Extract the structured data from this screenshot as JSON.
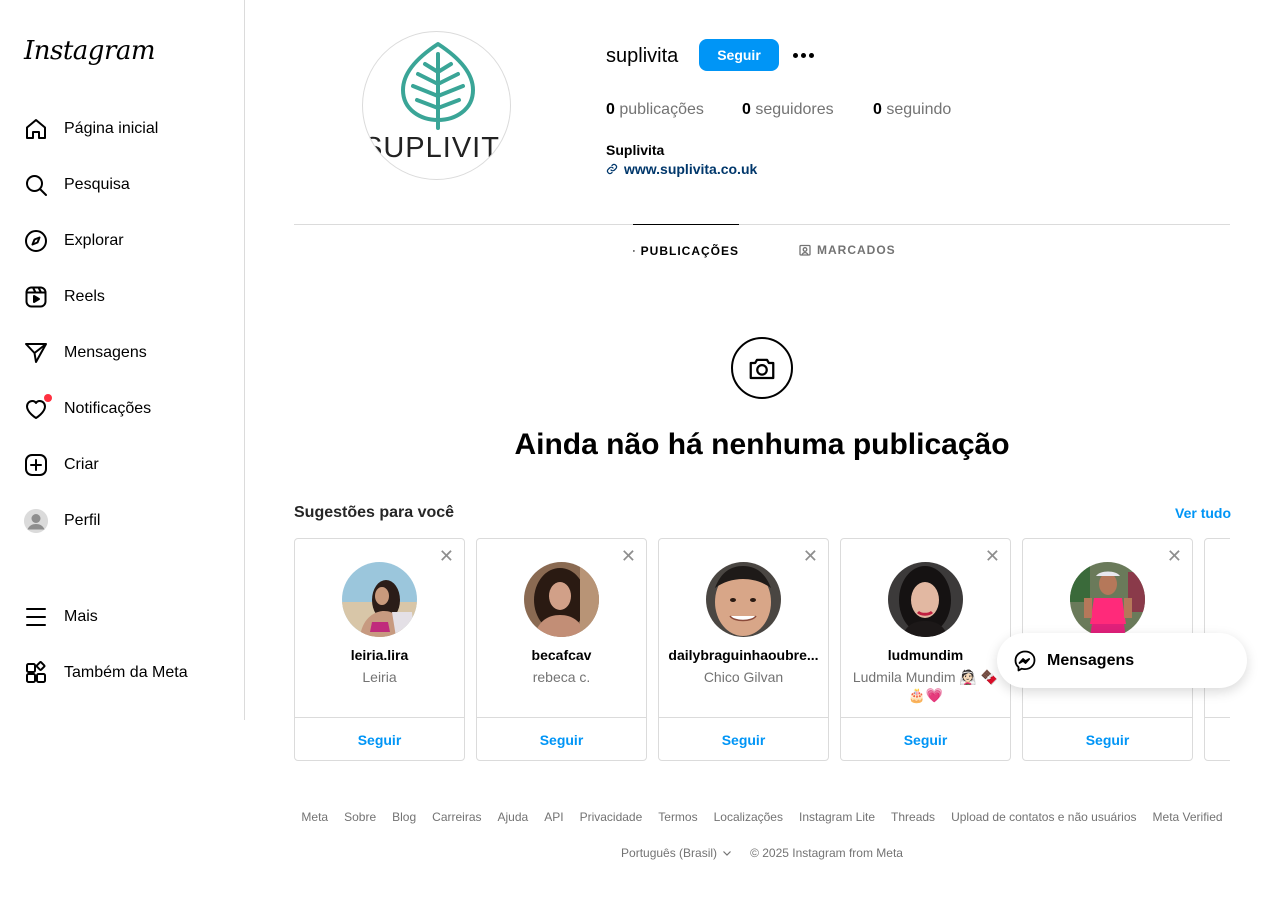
{
  "sidebar": {
    "logo": "Instagram",
    "items": [
      {
        "label": "Página inicial",
        "icon": "home-icon"
      },
      {
        "label": "Pesquisa",
        "icon": "search-icon"
      },
      {
        "label": "Explorar",
        "icon": "compass-icon"
      },
      {
        "label": "Reels",
        "icon": "reels-icon"
      },
      {
        "label": "Mensagens",
        "icon": "paper-plane-icon"
      },
      {
        "label": "Notificações",
        "icon": "heart-icon"
      },
      {
        "label": "Criar",
        "icon": "plus-square-icon"
      },
      {
        "label": "Perfil",
        "icon": "avatar-icon"
      }
    ],
    "more": {
      "label": "Mais",
      "icon": "menu-icon"
    },
    "meta": {
      "label": "Também da Meta",
      "icon": "grid-icon"
    }
  },
  "profile": {
    "username": "suplivita",
    "follow_label": "Seguir",
    "pic_text": "SUPLIVITA",
    "stats": {
      "posts_count": "0",
      "posts_label": "publicações",
      "followers_count": "0",
      "followers_label": "seguidores",
      "following_count": "0",
      "following_label": "seguindo"
    },
    "full_name": "Suplivita",
    "website": "www.suplivita.co.uk"
  },
  "tabs": [
    {
      "label": "PUBLICAÇÕES",
      "icon": "grid-icon",
      "active": true
    },
    {
      "label": "MARCADOS",
      "icon": "tagged-icon",
      "active": false
    }
  ],
  "empty_state": {
    "icon": "camera-icon",
    "title": "Ainda não há nenhuma publicação"
  },
  "suggestions": {
    "title": "Sugestões para você",
    "see_all": "Ver tudo",
    "follow_label": "Seguir",
    "cards": [
      {
        "username": "leiria.lira",
        "name": "Leiria"
      },
      {
        "username": "becafcav",
        "name": "rebeca c."
      },
      {
        "username": "dailybraguinhaoubre...",
        "name": "Chico Gilvan"
      },
      {
        "username": "ludmundim",
        "name": "Ludmila Mundim 👰🏻 🍫🎂💗"
      },
      {
        "username": "",
        "name": ""
      }
    ]
  },
  "messages_float": {
    "label": "Mensagens",
    "icon": "messenger-icon"
  },
  "footer": {
    "links": [
      "Meta",
      "Sobre",
      "Blog",
      "Carreiras",
      "Ajuda",
      "API",
      "Privacidade",
      "Termos",
      "Localizações",
      "Instagram Lite",
      "Threads",
      "Upload de contatos e não usuários",
      "Meta Verified"
    ],
    "language": "Português (Brasil)",
    "copyright": "© 2025 Instagram from Meta"
  },
  "colors": {
    "accent": "#0095f6",
    "link": "#00376b",
    "muted": "#737373",
    "border": "#dbdbdb",
    "notification": "#ff3040",
    "logo_leaf": "#3aa597"
  }
}
